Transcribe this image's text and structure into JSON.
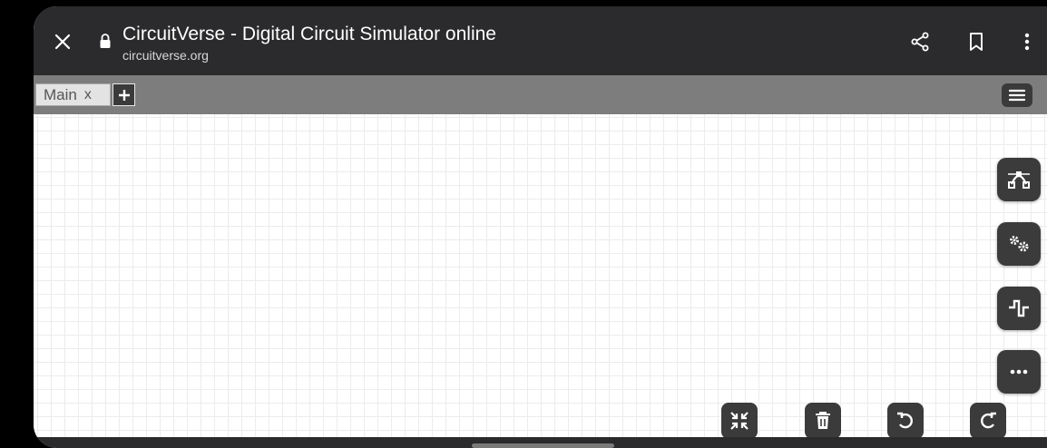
{
  "browser": {
    "title": "CircuitVerse - Digital Circuit Simulator online",
    "url": "circuitverse.org",
    "close_icon": "close-icon",
    "lock_icon": "lock-icon",
    "share_icon": "share-icon",
    "bookmark_icon": "bookmark-icon",
    "more_icon": "more-vertical-icon"
  },
  "tabs": [
    {
      "label": "Main",
      "close_label": "x"
    }
  ],
  "add_tab_icon": "plus-icon",
  "menu_icon": "hamburger-menu-icon",
  "side_buttons": [
    {
      "name": "wire-curve-button",
      "icon": "bezier-curve-icon"
    },
    {
      "name": "settings-button",
      "icon": "gears-icon"
    },
    {
      "name": "timing-diagram-button",
      "icon": "square-wave-icon"
    },
    {
      "name": "more-options-button",
      "icon": "ellipsis-icon"
    }
  ],
  "bottom_buttons": [
    {
      "name": "fit-to-screen-button",
      "icon": "compress-icon"
    },
    {
      "name": "delete-button",
      "icon": "trash-icon"
    },
    {
      "name": "undo-button",
      "icon": "undo-icon"
    },
    {
      "name": "redo-button",
      "icon": "redo-icon"
    }
  ],
  "colors": {
    "browser_bar": "#2b2b2d",
    "tab_bar": "#7d7d7d",
    "button_bg": "#3b3b3b",
    "grid_line": "#ececec"
  }
}
